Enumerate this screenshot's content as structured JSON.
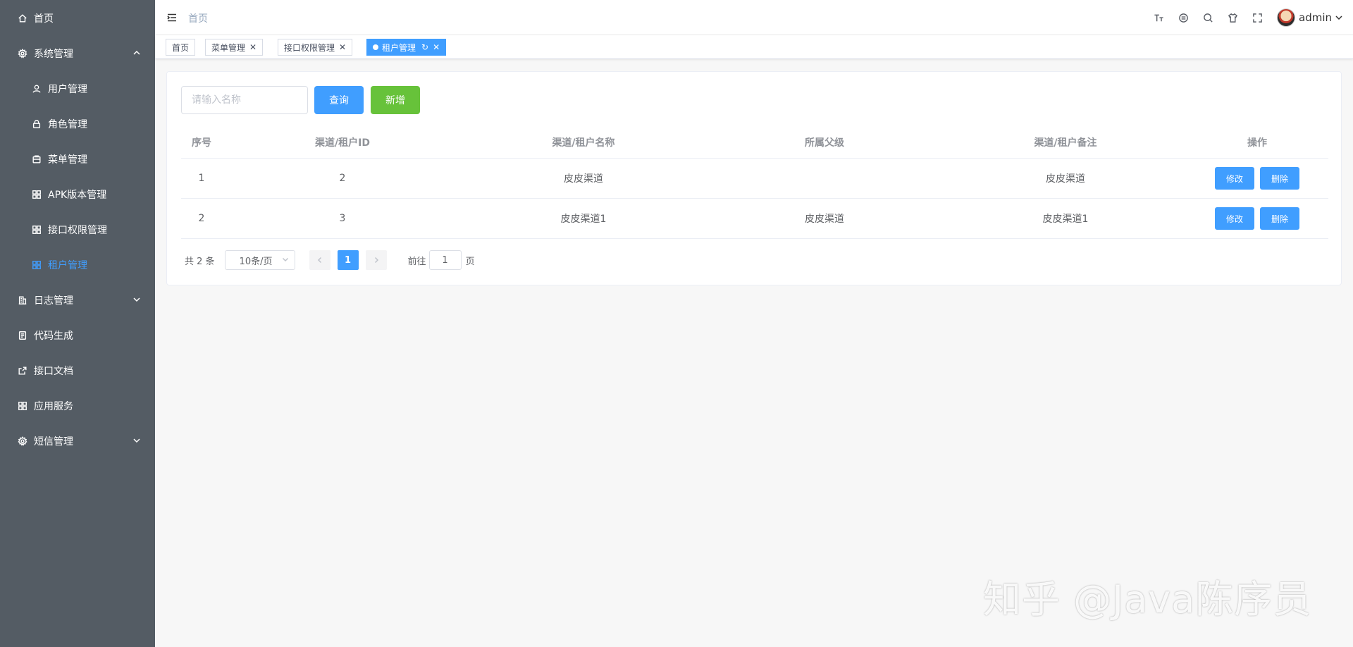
{
  "sidebar": {
    "items": [
      {
        "label": "首页",
        "icon": "home-icon"
      },
      {
        "label": "系统管理",
        "icon": "gear-icon",
        "expanded": true
      },
      {
        "label": "用户管理",
        "icon": "user-icon"
      },
      {
        "label": "角色管理",
        "icon": "lock-icon"
      },
      {
        "label": "菜单管理",
        "icon": "menu-box-icon"
      },
      {
        "label": "APK版本管理",
        "icon": "grid-icon"
      },
      {
        "label": "接口权限管理",
        "icon": "grid-icon"
      },
      {
        "label": "租户管理",
        "icon": "grid-icon",
        "active": true
      },
      {
        "label": "日志管理",
        "icon": "building-icon",
        "expanded": false
      },
      {
        "label": "代码生成",
        "icon": "document-icon"
      },
      {
        "label": "接口文档",
        "icon": "external-icon"
      },
      {
        "label": "应用服务",
        "icon": "grid-icon"
      },
      {
        "label": "短信管理",
        "icon": "gear-icon",
        "expanded": false
      }
    ],
    "active_color": "#409eff",
    "background": "#545c64"
  },
  "header": {
    "breadcrumb": "首页",
    "username": "admin"
  },
  "tags": [
    {
      "label": "首页",
      "closable": false
    },
    {
      "label": "菜单管理",
      "closable": true
    },
    {
      "label": "接口权限管理",
      "closable": true
    },
    {
      "label": "租户管理",
      "closable": true,
      "active": true
    }
  ],
  "search": {
    "placeholder": "请输入名称",
    "value": "",
    "query_label": "查询",
    "add_label": "新增"
  },
  "table": {
    "headers": [
      "序号",
      "渠道/租户ID",
      "渠道/租户名称",
      "所属父级",
      "渠道/租户备注",
      "操作"
    ],
    "rows": [
      {
        "index": "1",
        "id": "2",
        "name": "皮皮渠道",
        "parent": "",
        "remark": "皮皮渠道",
        "edit": "修改",
        "delete": "删除"
      },
      {
        "index": "2",
        "id": "3",
        "name": "皮皮渠道1",
        "parent": "皮皮渠道",
        "remark": "皮皮渠道1",
        "edit": "修改",
        "delete": "删除"
      }
    ]
  },
  "pagination": {
    "total": "共 2 条",
    "page_size": "10条/页",
    "current_page": "1",
    "goto_label": "前往",
    "goto_value": "1",
    "page_unit": "页"
  },
  "watermark": "知乎 @Java陈序员"
}
